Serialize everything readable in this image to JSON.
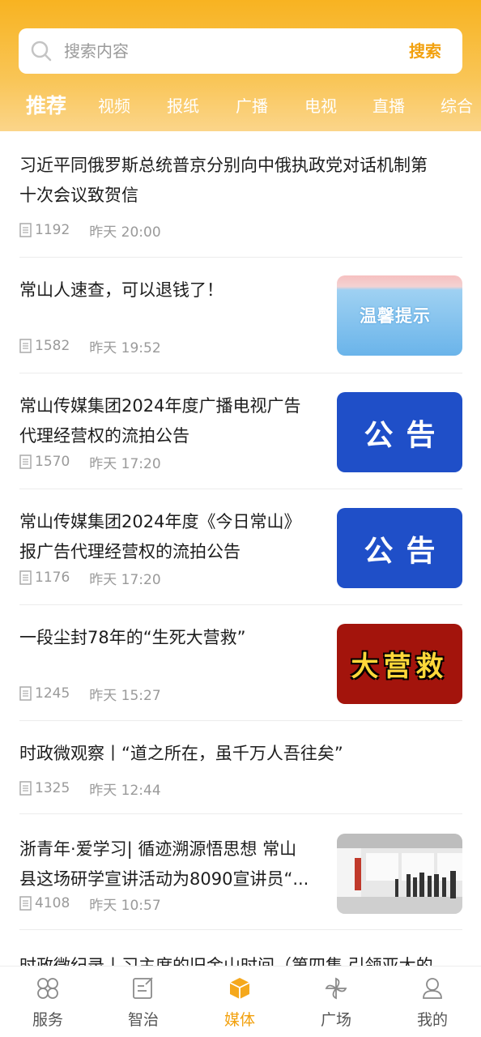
{
  "search": {
    "placeholder": "搜索内容",
    "button_label": "搜索"
  },
  "tabs": [
    {
      "label": "推荐",
      "active": true
    },
    {
      "label": "视频",
      "active": false
    },
    {
      "label": "报纸",
      "active": false
    },
    {
      "label": "广播",
      "active": false
    },
    {
      "label": "电视",
      "active": false
    },
    {
      "label": "直播",
      "active": false
    },
    {
      "label": "综合",
      "active": false
    }
  ],
  "news": [
    {
      "title_line1": "习近平同俄罗斯总统普京分别向中俄执政党对话机制第",
      "title_line2": "十次会议致贺信",
      "views": "1192",
      "time": "昨天 20:00"
    },
    {
      "title_line1": "常山人速查，可以退钱了！",
      "title_line2": "",
      "views": "1582",
      "time": "昨天 19:52",
      "thumb_text": "温馨提示"
    },
    {
      "title_line1": "常山传媒集团2024年度广播电视广告",
      "title_line2": "代理经营权的流拍公告",
      "views": "1570",
      "time": "昨天 17:20",
      "thumb_text": "公告"
    },
    {
      "title_line1": "常山传媒集团2024年度《今日常山》",
      "title_line2": "报广告代理经营权的流拍公告",
      "views": "1176",
      "time": "昨天 17:20",
      "thumb_text": "公告"
    },
    {
      "title_line1": "一段尘封78年的“生死大营救”",
      "title_line2": "",
      "views": "1245",
      "time": "昨天 15:27",
      "thumb_text": "大营救"
    },
    {
      "title_line1": "时政微观察丨“道之所在，虽千万人吾往矣”",
      "title_line2": "",
      "views": "1325",
      "time": "昨天 12:44"
    },
    {
      "title_line1": "浙青年·爱学习| 循迹溯源悟思想 常山",
      "title_line2": "县这场研学宣讲活动为8090宣讲员“...",
      "views": "4108",
      "time": "昨天 10:57"
    },
    {
      "title_line1": "时政微纪录丨习主席的旧金山时间（第四集 引领亚太的",
      "title_line2": ""
    }
  ],
  "bottom_nav": [
    {
      "label": "服务",
      "icon": "grid-petals-icon",
      "active": false
    },
    {
      "label": "智治",
      "icon": "edit-note-icon",
      "active": false
    },
    {
      "label": "媒体",
      "icon": "cube-icon",
      "active": true
    },
    {
      "label": "广场",
      "icon": "pinwheel-icon",
      "active": false
    },
    {
      "label": "我的",
      "icon": "user-icon",
      "active": false
    }
  ],
  "colors": {
    "accent": "#f2a10f",
    "header_top": "#f8b321",
    "notice_blue": "#1f4fc8",
    "rescue_red": "#a3140c"
  }
}
